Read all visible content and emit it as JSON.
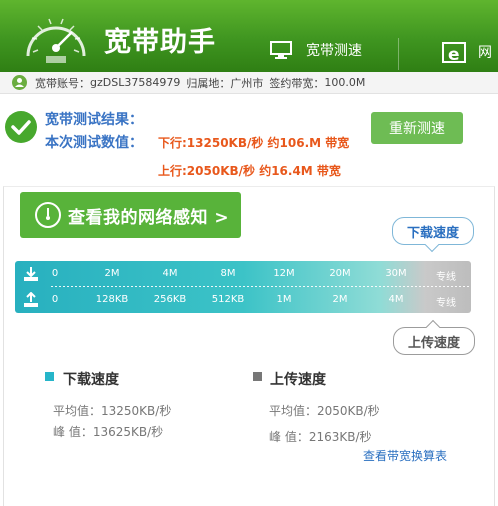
{
  "app": {
    "title": "宽带助手"
  },
  "tabs": {
    "speed_test": "宽带测速",
    "other": "网"
  },
  "account": {
    "label": "宽带账号：",
    "value": "gzDSL37584979",
    "location_label": "归属地：",
    "location": "广州市",
    "bandwidth_label": "签约带宽：",
    "bandwidth": "100.0M"
  },
  "result": {
    "title": "宽带测试结果：",
    "value_label": "本次测试数值：",
    "download": "下行:13250KB/秒 约106.M 带宽",
    "upload": "上行:2050KB/秒 约16.4M 带宽",
    "retest_button": "重新测速"
  },
  "net_button": "查看我的网络感知 >",
  "bubbles": {
    "download": "下载速度",
    "upload": "上传速度"
  },
  "scale": {
    "download_ticks": [
      "0",
      "2M",
      "4M",
      "8M",
      "12M",
      "20M",
      "30M",
      "专线"
    ],
    "upload_ticks": [
      "0",
      "128KB",
      "256KB",
      "512KB",
      "1M",
      "2M",
      "4M",
      "专线"
    ]
  },
  "stats": {
    "download": {
      "title": "下载速度",
      "avg": "平均值：13250KB/秒",
      "peak": "峰 值：13625KB/秒"
    },
    "upload": {
      "title": "上传速度",
      "avg": "平均值：2050KB/秒",
      "peak": "峰 值：2163KB/秒"
    }
  },
  "link": "查看带宽换算表",
  "colors": {
    "header_green": "#3f9520",
    "accent_orange": "#e8581c",
    "link_blue": "#2a6fc0",
    "download_cyan": "#26b5c9",
    "upload_gray": "#777777"
  }
}
